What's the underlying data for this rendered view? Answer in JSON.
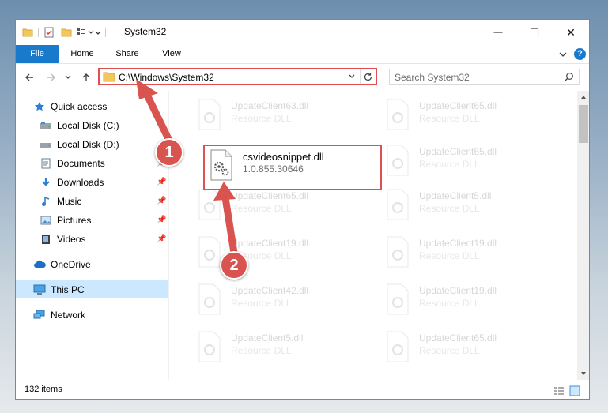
{
  "window": {
    "title": "System32",
    "controls": {
      "minimize": "—",
      "maximize": "☐",
      "close": "✕"
    }
  },
  "ribbon": {
    "tabs": [
      {
        "label": "File"
      },
      {
        "label": "Home"
      },
      {
        "label": "Share"
      },
      {
        "label": "View"
      }
    ],
    "help": "?"
  },
  "nav": {
    "address": "C:\\Windows\\System32",
    "search_placeholder": "Search System32"
  },
  "sidebar": {
    "items": [
      {
        "label": "Quick access",
        "icon": "star-icon"
      },
      {
        "label": "Local Disk (C:)",
        "icon": "drive-icon"
      },
      {
        "label": "Local Disk (D:)",
        "icon": "drive-icon"
      },
      {
        "label": "Documents",
        "icon": "documents-icon"
      },
      {
        "label": "Downloads",
        "icon": "download-icon"
      },
      {
        "label": "Music",
        "icon": "music-icon"
      },
      {
        "label": "Pictures",
        "icon": "pictures-icon"
      },
      {
        "label": "Videos",
        "icon": "videos-icon"
      },
      {
        "label": "OneDrive",
        "icon": "cloud-icon"
      },
      {
        "label": "This PC",
        "icon": "computer-icon"
      },
      {
        "label": "Network",
        "icon": "network-icon"
      }
    ]
  },
  "files": {
    "highlighted": {
      "name": "csvideosnippet.dll",
      "desc": "1.0.855.30646"
    },
    "faded": [
      {
        "name": "UpdateClient63.dll",
        "desc": "Resource DLL"
      },
      {
        "name": "UpdateClient65.dll",
        "desc": "Resource DLL"
      },
      {
        "name": "UpdateClient65.dll",
        "desc": "Resource DLL"
      },
      {
        "name": "UpdateClient65.dll",
        "desc": "Resource DLL"
      },
      {
        "name": "UpdateClient5.dll",
        "desc": "Resource DLL"
      },
      {
        "name": "UpdateClient19.dll",
        "desc": "Resource DLL"
      },
      {
        "name": "UpdateClient19.dll",
        "desc": "Resource DLL"
      },
      {
        "name": "UpdateClient42.dll",
        "desc": "Resource DLL"
      },
      {
        "name": "UpdateClient19.dll",
        "desc": "Resource DLL"
      },
      {
        "name": "UpdateClient5.dll",
        "desc": "Resource DLL"
      },
      {
        "name": "UpdateClient65.dll",
        "desc": "Resource DLL"
      }
    ]
  },
  "status": {
    "item_count": "132 items"
  },
  "annotations": {
    "step1": "1",
    "step2": "2",
    "color": "#d9534f"
  }
}
